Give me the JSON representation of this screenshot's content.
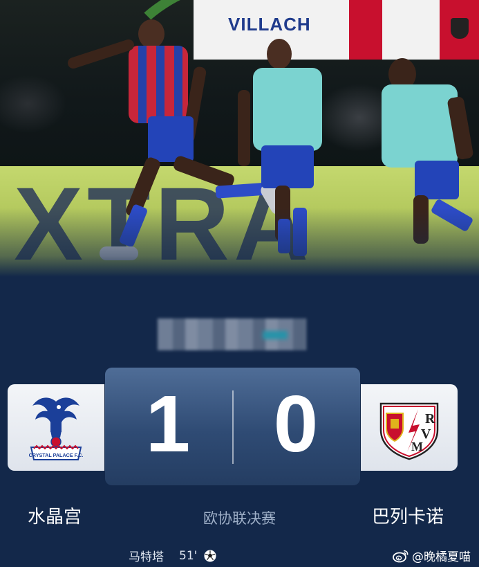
{
  "hero": {
    "banner_text": "VILLACH",
    "board_text": "XTRA"
  },
  "match": {
    "home_team": {
      "name": "水晶宫",
      "score": "1",
      "crest_icon": "crystal-palace-crest-icon",
      "crest_text": "CRYSTAL PALACE F.C."
    },
    "away_team": {
      "name": "巴列卡诺",
      "score": "0",
      "crest_icon": "rayo-vallecano-crest-icon",
      "crest_text": "RVM"
    },
    "competition": "欧协联决赛",
    "scorer": {
      "name": "马特塔",
      "minute": "51'",
      "icon": "soccer-ball-icon"
    }
  },
  "watermark": {
    "icon": "weibo-icon",
    "text": "@晚橘夏喵"
  },
  "colors": {
    "background": "#13284a",
    "score_panel": "#2f4b74",
    "card": "#eef1f5"
  }
}
